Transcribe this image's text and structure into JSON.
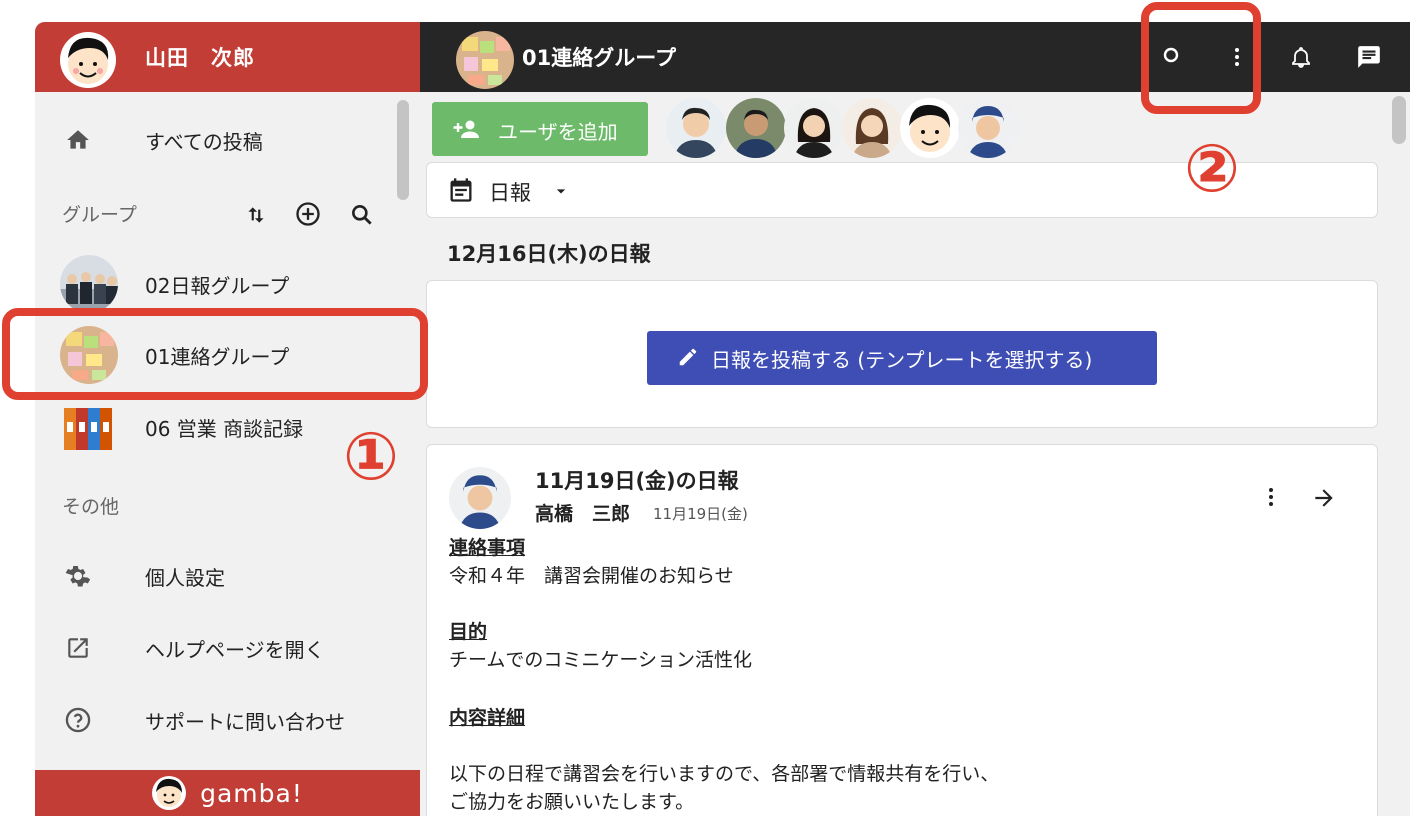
{
  "user": {
    "name": "山田　次郎"
  },
  "nav": {
    "all_posts": "すべての投稿",
    "groups_label": "グループ",
    "groups": [
      {
        "label": "02日報グループ"
      },
      {
        "label": "01連絡グループ"
      },
      {
        "label": "06 営業 商談記録"
      }
    ],
    "other_label": "その他",
    "settings": "個人設定",
    "help": "ヘルプページを開く",
    "support": "サポートに問い合わせ"
  },
  "brand": {
    "name": "gamba!"
  },
  "header": {
    "group_title": "01連絡グループ"
  },
  "toolbar": {
    "add_user_label": "ユーザを追加"
  },
  "filter": {
    "label": "日報"
  },
  "today": {
    "heading": "12月16日(木)の日報",
    "post_button": "日報を投稿する (テンプレートを選択する)"
  },
  "entry": {
    "title": "11月19日(金)の日報",
    "author": "高橋　三郎",
    "date": "11月19日(金)",
    "sections": {
      "h1": "連絡事項",
      "t1": "令和４年　講習会開催のお知らせ",
      "h2": "目的",
      "t2": "チームでのコミニケーション活性化",
      "h3": "内容詳細",
      "t3": "以下の日程で講習会を行いますので、各部署で情報共有を行い、",
      "t4": "ご協力をお願いいたします。"
    }
  },
  "annotations": {
    "one": "①",
    "two": "②"
  },
  "colors": {
    "brand_red": "#c23d35",
    "annotation_red": "#e0402f",
    "post_blue": "#3f4eb5",
    "add_green": "#6dbb6a"
  }
}
